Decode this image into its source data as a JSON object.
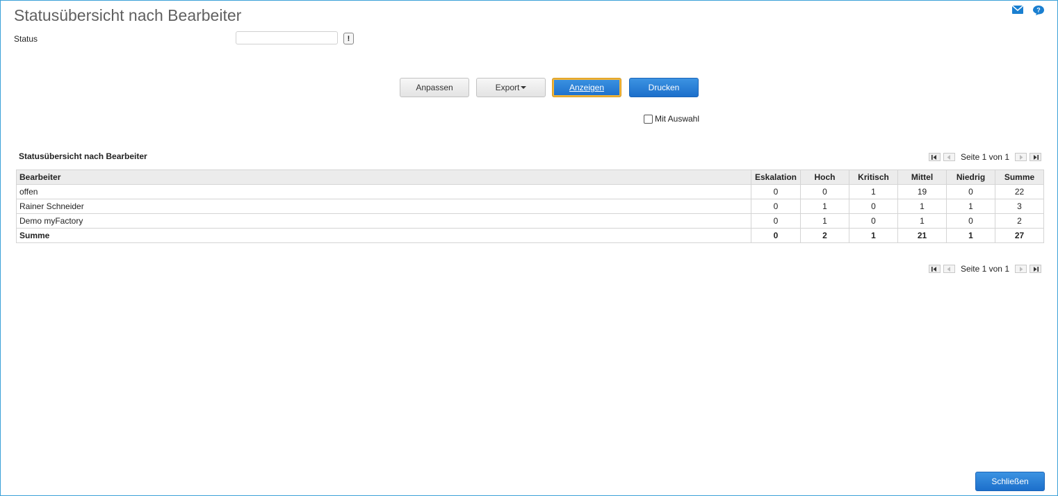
{
  "page": {
    "title": "Statusübersicht nach Bearbeiter",
    "status_label": "Status",
    "status_value": "",
    "status_button": "!"
  },
  "buttons": {
    "anpassen": "Anpassen",
    "export": "Export",
    "anzeigen": "Anzeigen",
    "drucken": "Drucken",
    "schliessen": "Schließen"
  },
  "mit_auswahl": "Mit Auswahl",
  "report": {
    "title": "Statusübersicht nach Bearbeiter",
    "pager_text": "Seite 1 von 1",
    "columns": [
      "Bearbeiter",
      "Eskalation",
      "Hoch",
      "Kritisch",
      "Mittel",
      "Niedrig",
      "Summe"
    ],
    "rows": [
      [
        "offen",
        "0",
        "0",
        "1",
        "19",
        "0",
        "22"
      ],
      [
        "Rainer Schneider",
        "0",
        "1",
        "0",
        "1",
        "1",
        "3"
      ],
      [
        "Demo myFactory",
        "0",
        "1",
        "0",
        "1",
        "0",
        "2"
      ]
    ],
    "total": [
      "Summe",
      "0",
      "2",
      "1",
      "21",
      "1",
      "27"
    ]
  },
  "colors": {
    "accent": "#1c6fcb",
    "frame": "#3aa0d8",
    "focus": "#f2b53a"
  },
  "icons": [
    "mail-icon",
    "help-icon",
    "first-page-icon",
    "prev-page-icon",
    "next-page-icon",
    "last-page-icon"
  ]
}
